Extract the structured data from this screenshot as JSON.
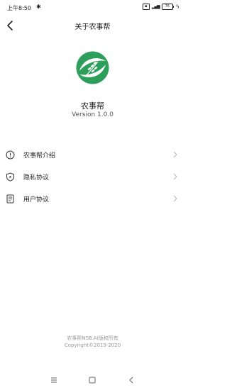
{
  "status_bar": {
    "time": "上午8:50",
    "battery_level": "76"
  },
  "nav": {
    "title": "关于农事帮"
  },
  "app": {
    "name": "农事帮",
    "version": "Version 1.0.0"
  },
  "menu": {
    "items": [
      {
        "label": "农事帮介绍",
        "icon": "info-icon"
      },
      {
        "label": "隐私协议",
        "icon": "shield-icon"
      },
      {
        "label": "用户协议",
        "icon": "document-icon"
      }
    ]
  },
  "footer": {
    "company": "农事帮NSB.AI版权所有",
    "copyright": "Copyright©2019-2020"
  },
  "colors": {
    "brand_green": "#2e9f5b",
    "text": "#222222",
    "muted": "#999999"
  }
}
